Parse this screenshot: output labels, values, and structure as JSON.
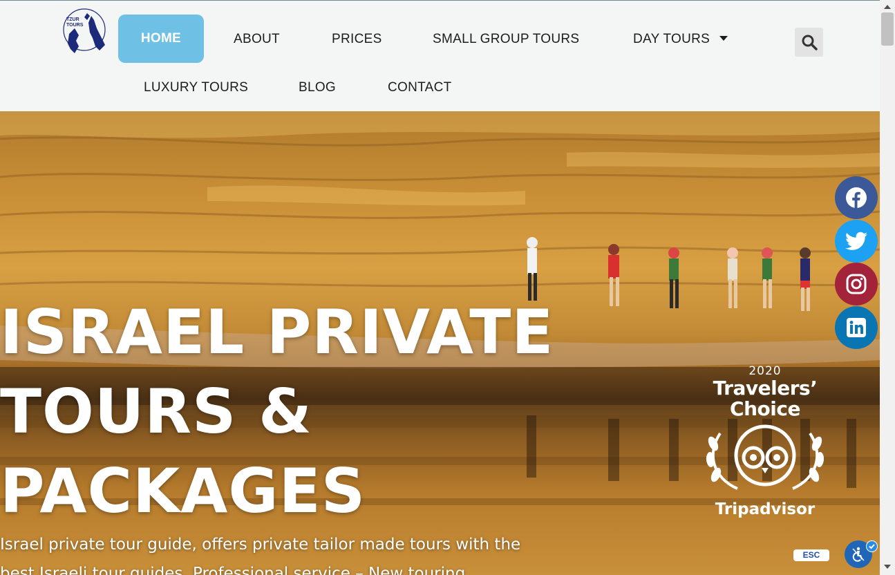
{
  "nav": {
    "logo_text": "TZUR TOURS",
    "items": [
      "HOME",
      "ABOUT",
      "PRICES",
      "SMALL GROUP TOURS",
      "DAY TOURS",
      "LUXURY TOURS",
      "BLOG",
      "CONTACT"
    ]
  },
  "hero": {
    "title": "ISRAEL PRIVATE TOURS & PACKAGES",
    "subtitle": "Israel private tour guide, offers private tailor made tours with the best Israeli tour guides. Professional service – New touring"
  },
  "award": {
    "year": "2020",
    "title_line1": "Travelers’",
    "title_line2": "Choice",
    "brand": "Tripadvisor"
  },
  "social": [
    "facebook-icon",
    "twitter-icon",
    "instagram-icon",
    "linkedin-icon"
  ],
  "accessibility": {
    "esc_label": "ESC"
  },
  "colors": {
    "accent": "#6ec1e4",
    "facebook": "#3b5998",
    "twitter": "#1da1f2",
    "instagram": "#a3233b",
    "linkedin": "#0a75b3"
  }
}
